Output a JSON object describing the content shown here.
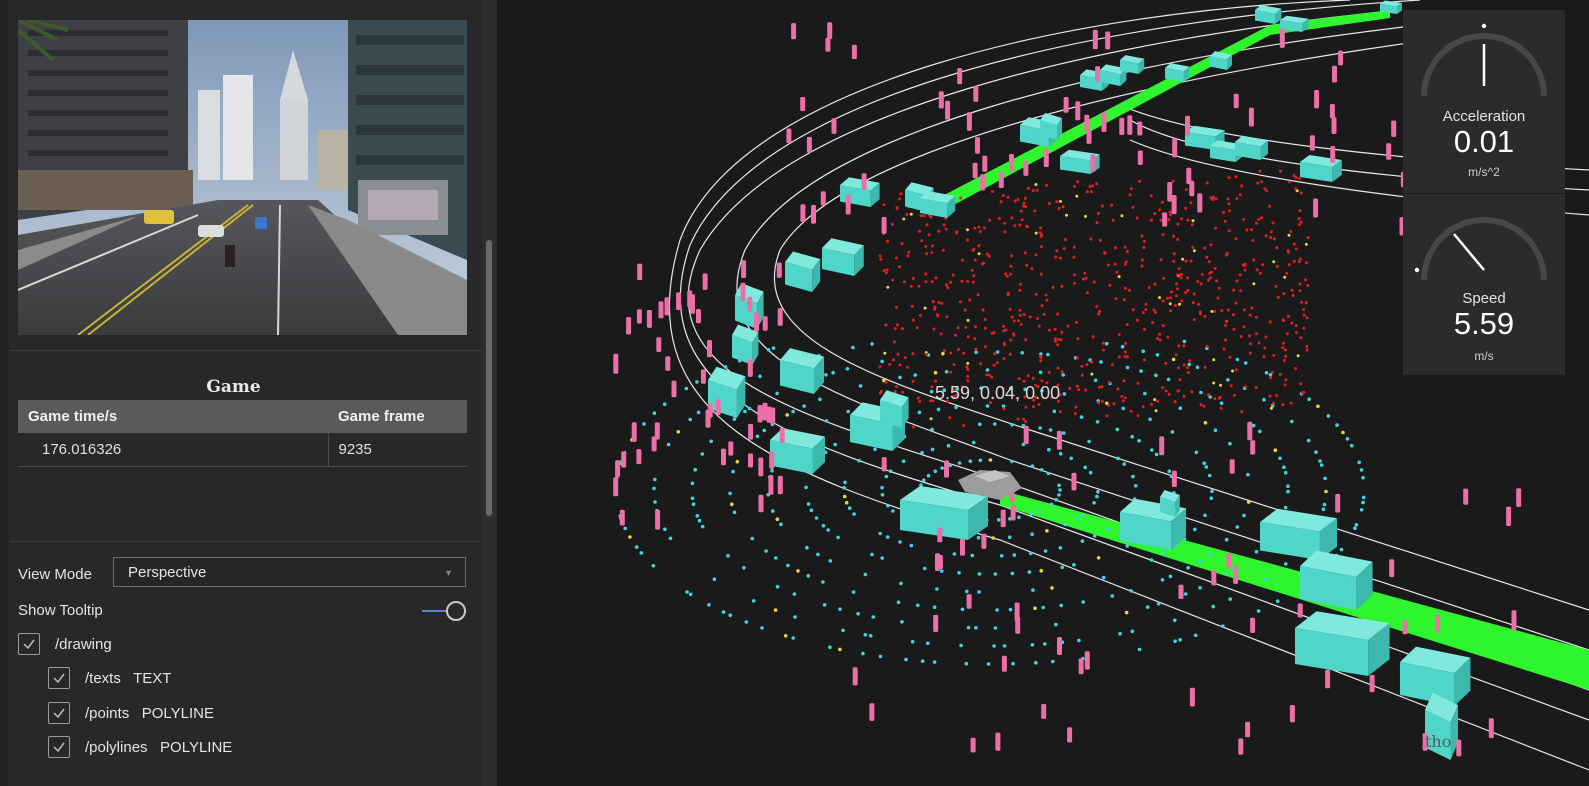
{
  "game_panel": {
    "title": "Game",
    "columns": [
      "Game time/s",
      "Game frame"
    ],
    "rows": [
      [
        "176.016326",
        "9235"
      ]
    ]
  },
  "controls": {
    "view_mode_label": "View Mode",
    "view_mode_value": "Perspective",
    "show_tooltip_label": "Show Tooltip",
    "show_tooltip_on": true,
    "streams": [
      {
        "label": "/drawing",
        "checked": true
      },
      {
        "label": "/texts   TEXT",
        "checked": true
      },
      {
        "label": "/points   POLYLINE",
        "checked": true
      },
      {
        "label": "/polylines   POLYLINE",
        "checked": true
      }
    ]
  },
  "viewport": {
    "hover_tooltip": "5.59, 0.04, 0.00",
    "watermark_fragment": "tho"
  },
  "gauges": [
    {
      "label": "Acceleration",
      "value": "0.01",
      "unit": "m/s^2"
    },
    {
      "label": "Speed",
      "value": "5.59",
      "unit": "m/s"
    }
  ],
  "colors": {
    "lane": "#2ef52e",
    "vehicle_box": "#4fd6c9",
    "pedestrian_marker": "#ec6fa8",
    "point_near": "#3fd4e4",
    "point_far": "#e02020",
    "toggle_accent": "#4c86d4"
  }
}
